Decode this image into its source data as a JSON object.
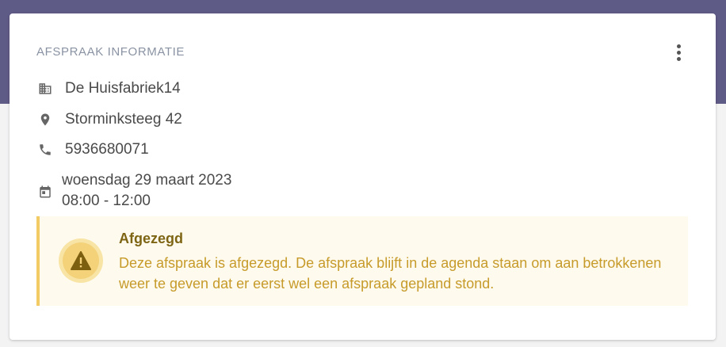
{
  "card": {
    "title": "AFSPRAAK INFORMATIE"
  },
  "details": {
    "company": "De Huisfabriek14",
    "address": "Storminksteeg 42",
    "phone": "5936680071",
    "date": "woensdag 29 maart 2023",
    "time": "08:00 - 12:00"
  },
  "alert": {
    "title": "Afgezegd",
    "message": "Deze afspraak is afgezegd. De afspraak blijft in de agenda staan om aan betrokkenen weer te geven dat er eerst wel een afspraak gepland stond."
  },
  "icons": {
    "company": "office-building-icon",
    "address": "map-marker-icon",
    "phone": "phone-icon",
    "date": "calendar-icon",
    "alert": "warning-icon",
    "menu": "more-vertical-icon"
  },
  "colors": {
    "header_band": "#5f5b87",
    "alert_background": "#fffaee",
    "alert_border": "#f2cb64",
    "alert_title": "#7d6514",
    "alert_text": "#c69b2a"
  }
}
